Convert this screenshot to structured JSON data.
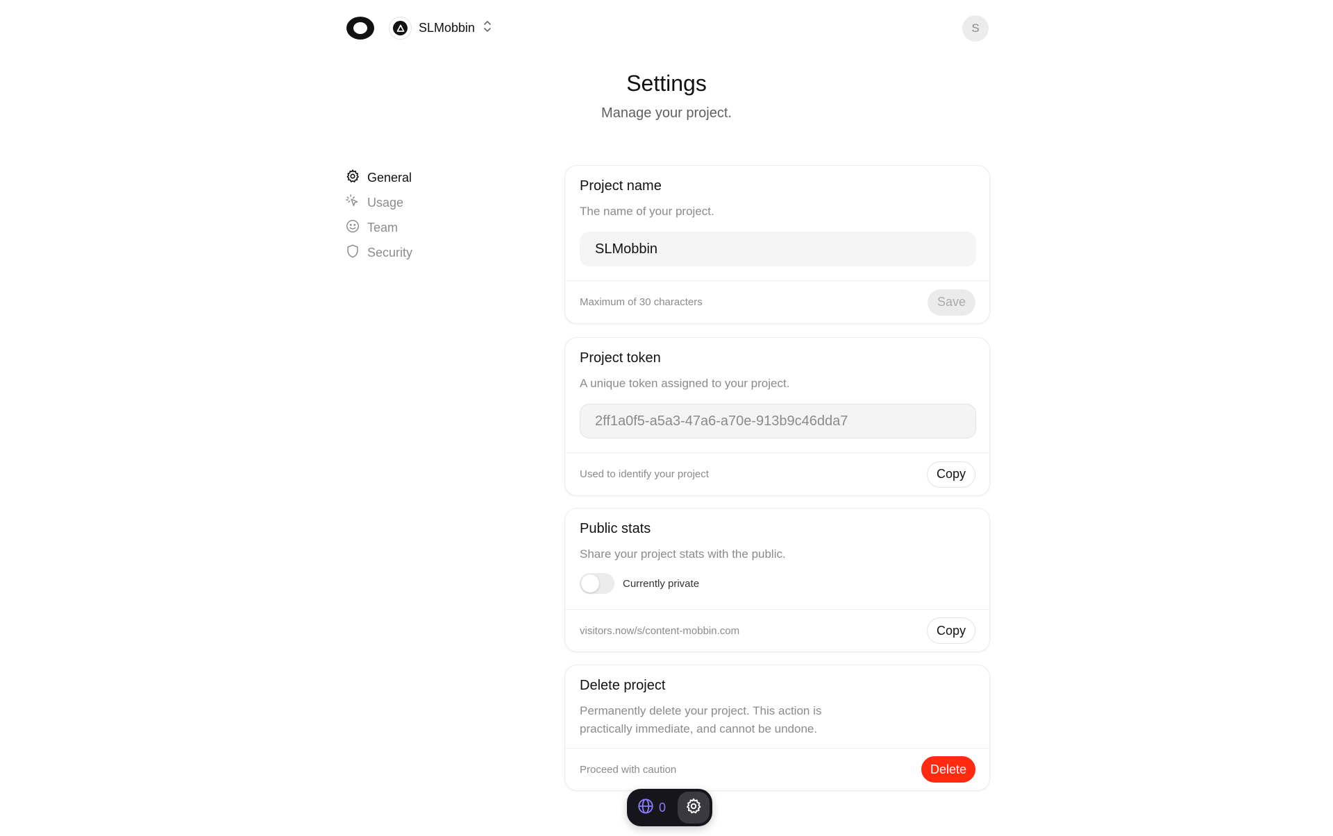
{
  "header": {
    "project_name": "SLMobbin",
    "user_initial": "S"
  },
  "page": {
    "title": "Settings",
    "subtitle": "Manage your project."
  },
  "sidebar": {
    "items": [
      {
        "label": "General",
        "icon": "gear-icon",
        "active": true
      },
      {
        "label": "Usage",
        "icon": "cursor-click-icon",
        "active": false
      },
      {
        "label": "Team",
        "icon": "smiley-icon",
        "active": false
      },
      {
        "label": "Security",
        "icon": "shield-icon",
        "active": false
      }
    ]
  },
  "cards": {
    "project_name": {
      "title": "Project name",
      "description": "The name of your project.",
      "value": "SLMobbin",
      "footer": "Maximum of 30 characters",
      "button": "Save"
    },
    "project_token": {
      "title": "Project token",
      "description": "A unique token assigned to your project.",
      "value": "2ff1a0f5-a5a3-47a6-a70e-913b9c46dda7",
      "footer": "Used to identify your project",
      "button": "Copy"
    },
    "public_stats": {
      "title": "Public stats",
      "description": "Share your project stats with the public.",
      "toggle_label": "Currently private",
      "toggle_on": false,
      "footer": "visitors.now/s/content-mobbin.com",
      "button": "Copy"
    },
    "delete_project": {
      "title": "Delete project",
      "description_line1": "Permanently delete your project. This action is",
      "description_line2": "practically immediate, and cannot be undone.",
      "footer": "Proceed with caution",
      "button": "Delete"
    }
  },
  "floating_bar": {
    "visitor_count": "0"
  },
  "colors": {
    "danger": "#ff2a0f",
    "accent": "#8b7cff"
  }
}
